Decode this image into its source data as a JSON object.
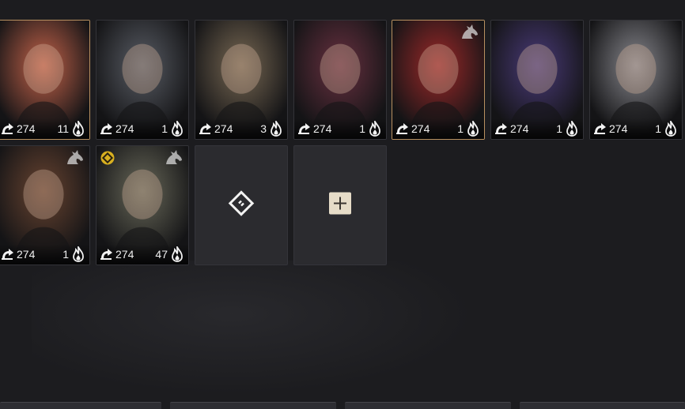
{
  "header": {
    "ghost_title": ""
  },
  "colors": {
    "accent": "#b89060",
    "background": "#1c1c1f"
  },
  "characters": [
    {
      "level": "274",
      "count": "11",
      "selected": true,
      "horse": false,
      "badge": false,
      "tone": "#c8644a"
    },
    {
      "level": "274",
      "count": "1",
      "selected": false,
      "horse": false,
      "badge": false,
      "tone": "#5a5e66"
    },
    {
      "level": "274",
      "count": "3",
      "selected": false,
      "horse": false,
      "badge": false,
      "tone": "#7a6a54"
    },
    {
      "level": "274",
      "count": "1",
      "selected": false,
      "horse": false,
      "badge": false,
      "tone": "#6a3040"
    },
    {
      "level": "274",
      "count": "1",
      "selected": true,
      "horse": true,
      "badge": false,
      "tone": "#a02828"
    },
    {
      "level": "274",
      "count": "1",
      "selected": false,
      "horse": false,
      "badge": false,
      "tone": "#4a3a7a"
    },
    {
      "level": "274",
      "count": "1",
      "selected": false,
      "horse": false,
      "badge": false,
      "tone": "#8a8a90"
    },
    {
      "level": "274",
      "count": "1",
      "selected": false,
      "horse": true,
      "badge": false,
      "tone": "#6a4430"
    },
    {
      "level": "274",
      "count": "47",
      "selected": false,
      "horse": true,
      "badge": true,
      "tone": "#6a6a5a"
    }
  ],
  "empty_slots": [
    {
      "icon": "rotate-diamond-icon"
    },
    {
      "icon": "plus-icon"
    }
  ],
  "icons": {
    "level": "shield-arm-icon",
    "count": "flame-icon",
    "mount": "horse-icon",
    "badge": "gold-diamond-badge-icon"
  }
}
